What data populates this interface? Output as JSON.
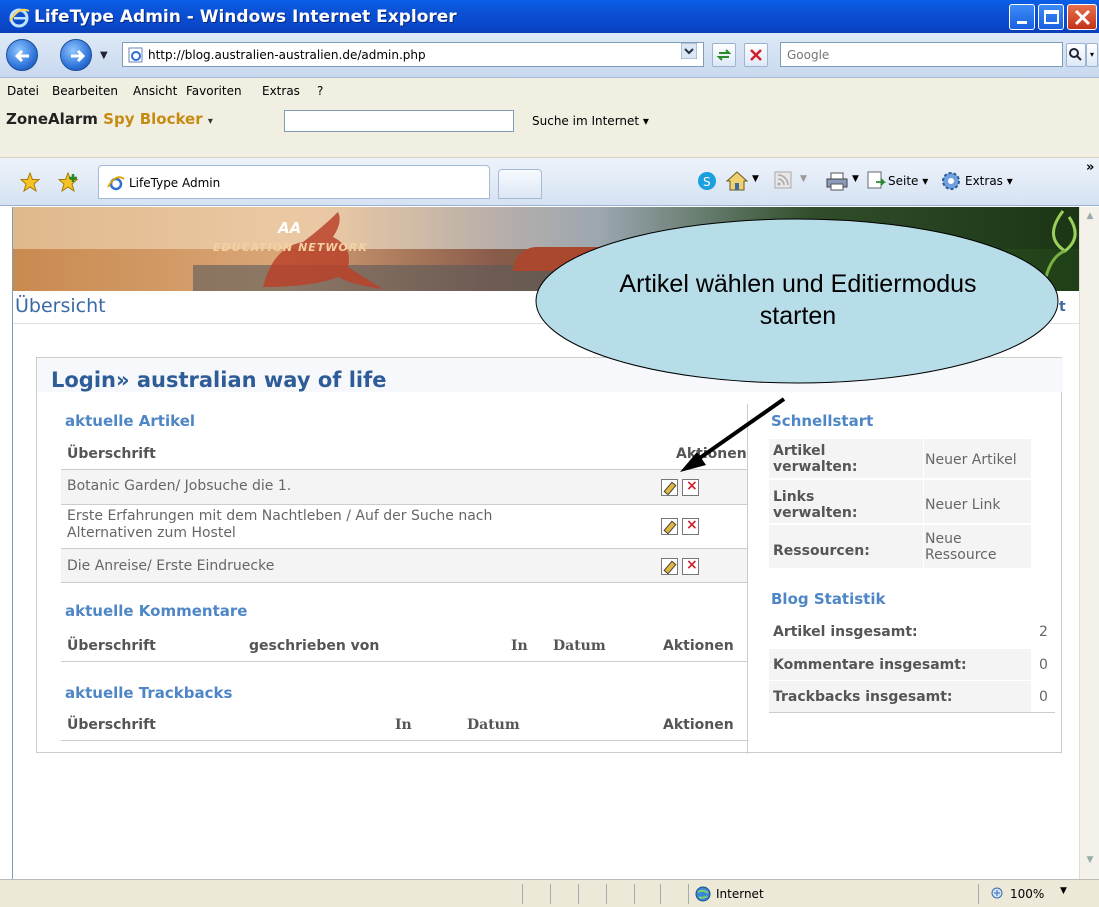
{
  "window": {
    "title": "LifeType Admin - Windows Internet Explorer"
  },
  "address_bar": {
    "url": "http://blog.australien-australien.de/admin.php",
    "search_placeholder": "Google"
  },
  "menu": {
    "items": [
      "Datei",
      "Bearbeiten",
      "Ansicht",
      "Favoriten",
      "Extras",
      "?"
    ]
  },
  "zonealarm": {
    "brand_prefix": "ZoneAlarm",
    "brand_suffix": "Spy Blocker",
    "search_label": "Suche im Internet"
  },
  "tabs": {
    "active_label": "LifeType Admin",
    "commands": {
      "page": "Seite",
      "tools": "Extras"
    }
  },
  "banner": {
    "logo_aa": "AA",
    "logo_sub": "EDUCATION NETWORK"
  },
  "page": {
    "title": "Übersicht",
    "right_link_fragment": "t"
  },
  "panel": {
    "login_prefix": "Login»",
    "blog_name": "australian way of life",
    "articles": {
      "heading": "aktuelle Artikel",
      "col_title": "Überschrift",
      "col_actions": "Aktionen",
      "rows": [
        {
          "title_line1": "Botanic Garden/ Jobsuche die 1.",
          "title_line2": ""
        },
        {
          "title_line1": "Erste Erfahrungen mit dem Nachtleben / Auf der Suche nach",
          "title_line2": "Alternativen zum Hostel"
        },
        {
          "title_line1": "Die Anreise/ Erste Eindruecke",
          "title_line2": ""
        }
      ]
    },
    "comments": {
      "heading": "aktuelle Kommentare",
      "cols": [
        "Überschrift",
        "geschrieben von",
        "In",
        "Datum",
        "Aktionen"
      ]
    },
    "trackbacks": {
      "heading": "aktuelle Trackbacks",
      "cols": [
        "Überschrift",
        "In",
        "Datum",
        "Aktionen"
      ]
    }
  },
  "sidebar": {
    "quickstart_heading": "Schnellstart",
    "quickstart": [
      {
        "label_line1": "Artikel",
        "label_line2": "verwalten:",
        "action_line1": "Neuer Artikel",
        "action_line2": ""
      },
      {
        "label_line1": "Links",
        "label_line2": "verwalten:",
        "action_line1": "Neuer Link",
        "action_line2": ""
      },
      {
        "label_line1": "Ressourcen:",
        "label_line2": "",
        "action_line1": "Neue",
        "action_line2": "Ressource"
      }
    ],
    "stats_heading": "Blog Statistik",
    "stats": [
      {
        "label": "Artikel insgesamt:",
        "value": "2"
      },
      {
        "label": "Kommentare insgesamt:",
        "value": "0"
      },
      {
        "label": "Trackbacks insgesamt:",
        "value": "0"
      }
    ]
  },
  "callout": {
    "line1": "Artikel wählen und Editiermodus",
    "line2": "starten"
  },
  "status": {
    "zone": "Internet",
    "zoom": "100%"
  },
  "colors": {
    "link_blue": "#4f86c6",
    "title_blue": "#2e5c97",
    "callout_fill": "#b7dde8"
  }
}
